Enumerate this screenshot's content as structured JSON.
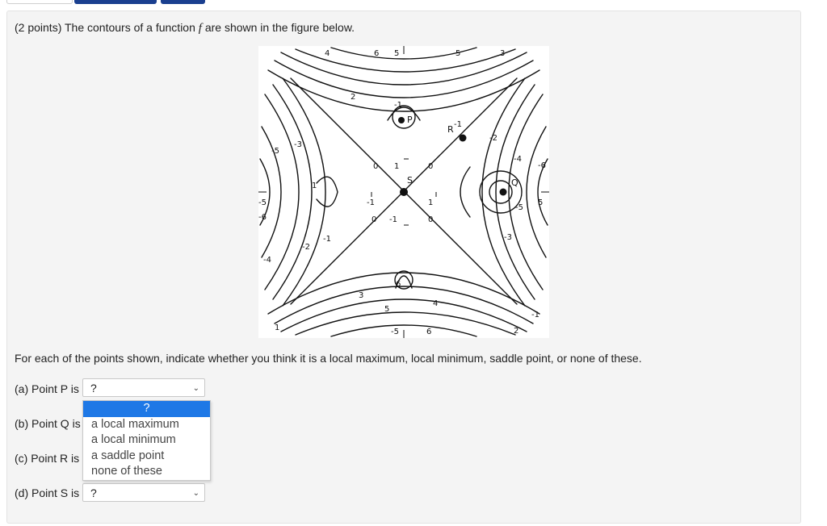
{
  "question": {
    "prefix": "(2 points) The contours of a function ",
    "func": "f",
    "suffix": " are shown in the figure below."
  },
  "instruction": "For each of the points shown, indicate whether you think it is a local maximum, local minimum, saddle point, or none of these.",
  "parts": [
    {
      "label": "(a) Point P is",
      "value": "?"
    },
    {
      "label": "(b) Point Q is",
      "value": ""
    },
    {
      "label": "(c) Point R is",
      "value": ""
    },
    {
      "label": "(d) Point S is",
      "value": "?"
    }
  ],
  "dropdown_options": [
    "?",
    "a local maximum",
    "a local minimum",
    "a saddle point",
    "none of these"
  ],
  "figure": {
    "points": [
      "P",
      "Q",
      "R",
      "S"
    ],
    "labels": {
      "top": [
        "4",
        "6",
        "5",
        "5",
        "3",
        "2",
        "-1",
        "1",
        "-2",
        "-4",
        "-6"
      ],
      "left": [
        "-5",
        "-3",
        "1",
        "-5",
        "-6",
        "-2",
        "-1",
        "-4"
      ],
      "center": [
        "0",
        "1",
        "0",
        "-1",
        "1",
        "0",
        "-1",
        "0"
      ],
      "right": [
        "5",
        "-5",
        "-3"
      ],
      "bottom": [
        "3",
        "5",
        "6",
        "4",
        "-1",
        "1",
        "-5",
        "-6",
        "2"
      ]
    }
  },
  "colors": {
    "accent": "#1e78e6",
    "tab": "#1a3f8f"
  }
}
